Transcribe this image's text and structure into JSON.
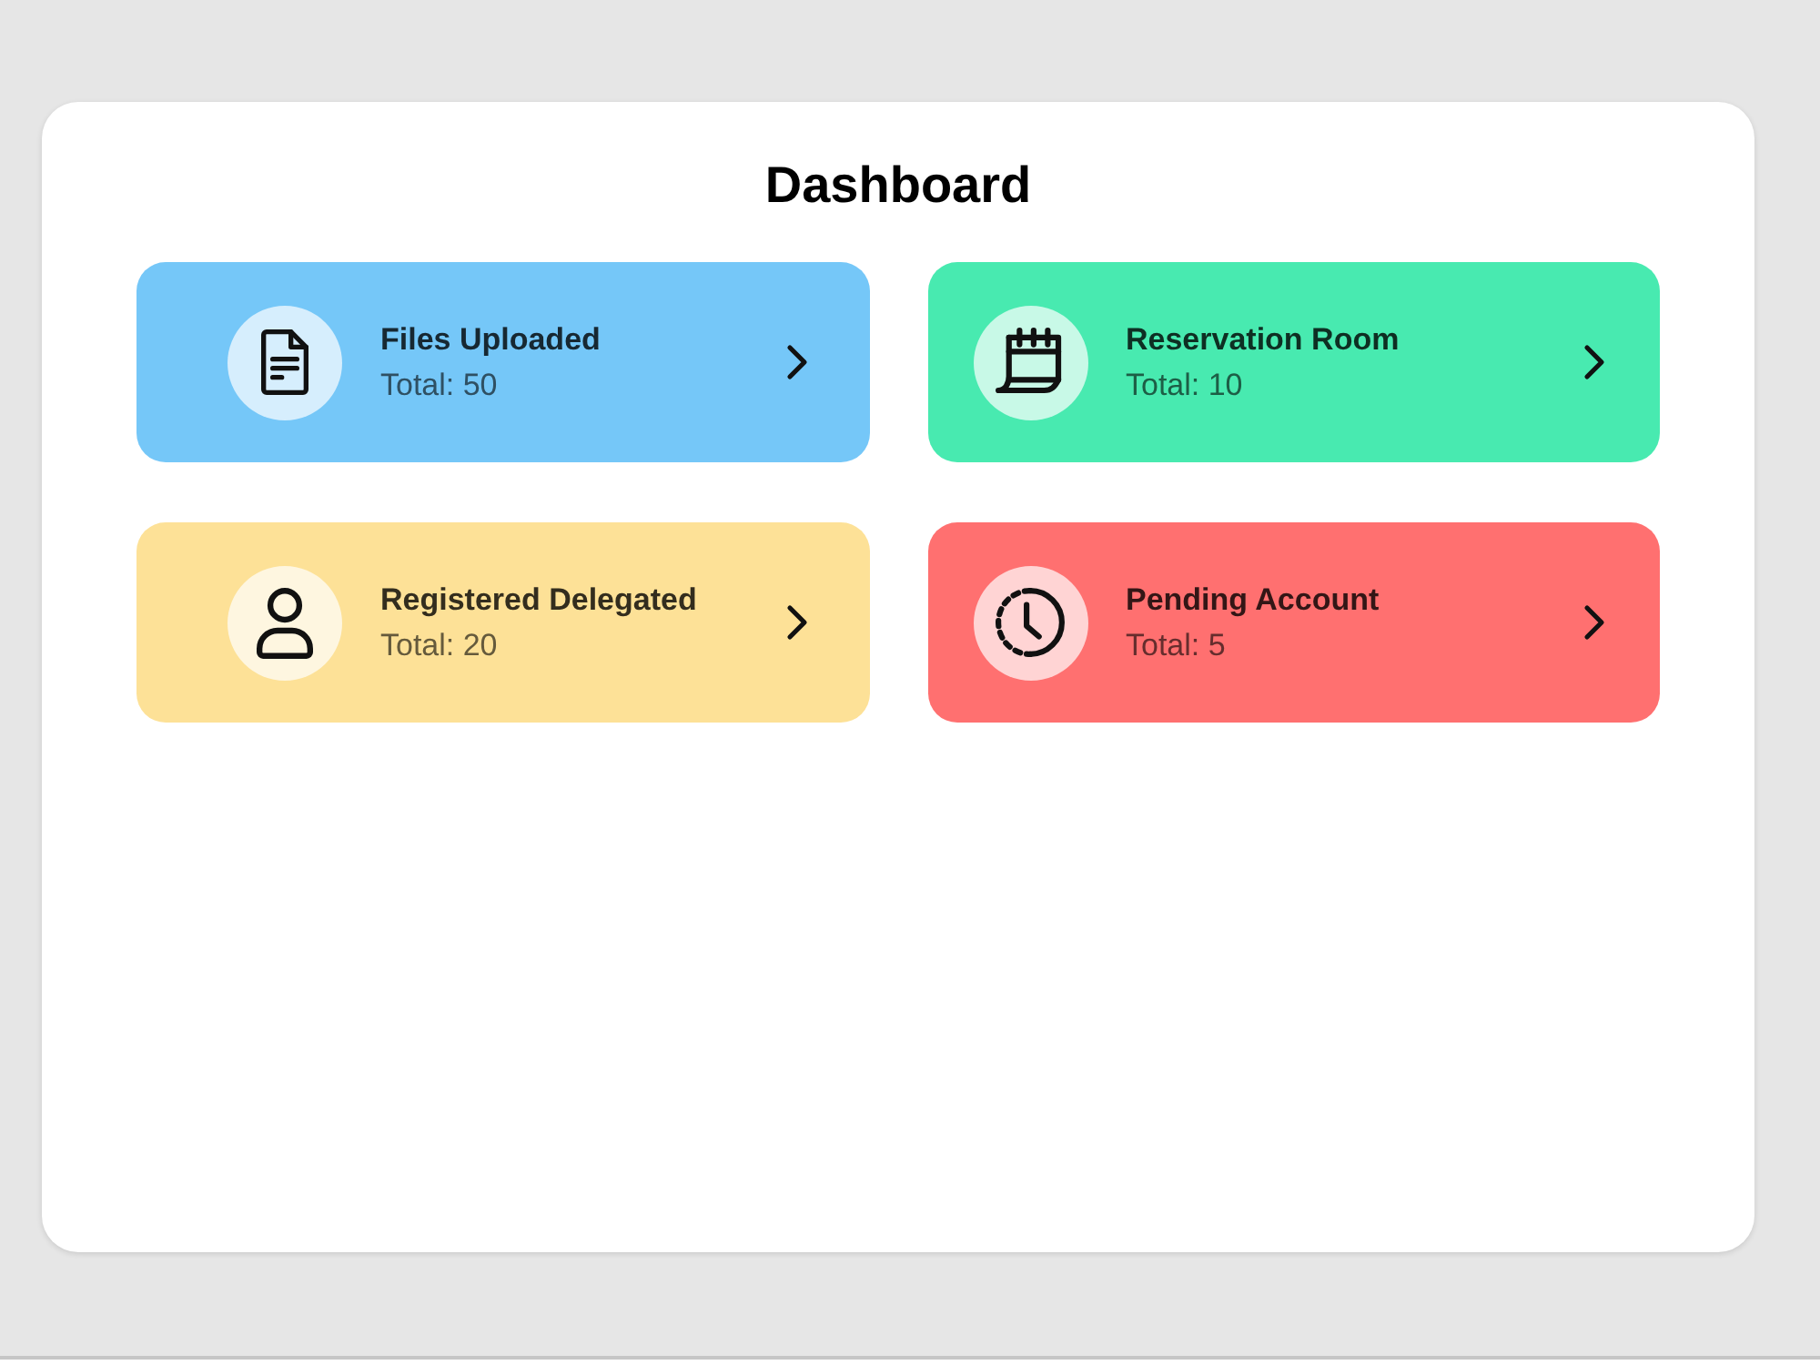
{
  "page": {
    "title": "Dashboard"
  },
  "cards": [
    {
      "kind": "document",
      "title": "Files Uploaded",
      "total": "Total: 50",
      "color": "#75c7f8"
    },
    {
      "kind": "calendar",
      "title": "Reservation Room",
      "total": "Total: 10",
      "color": "#48eab0"
    },
    {
      "kind": "user",
      "title": "Registered Delegated",
      "total": "Total: 20",
      "color": "#fde197"
    },
    {
      "kind": "clock",
      "title": "Pending Account",
      "total": "Total: 5",
      "color": "#ff7070"
    }
  ]
}
